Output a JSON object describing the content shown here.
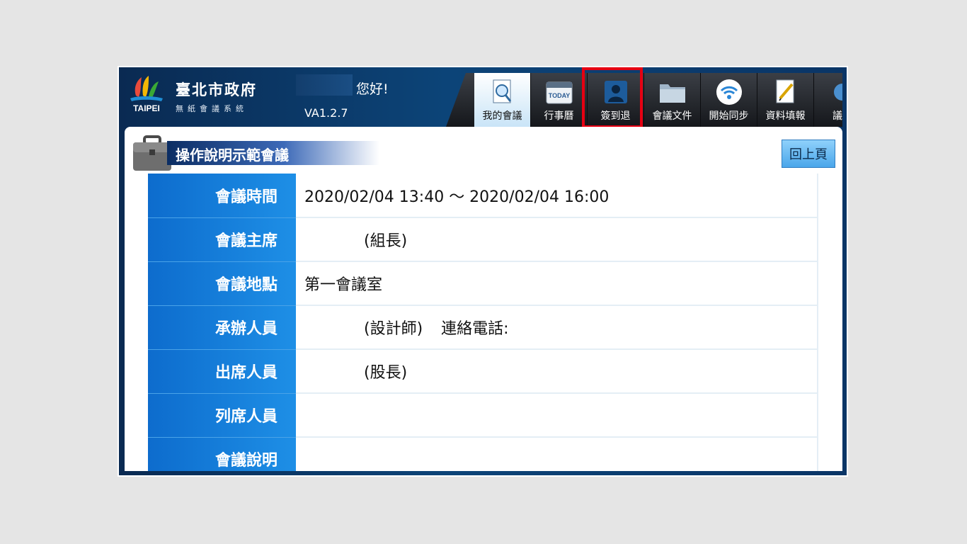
{
  "header": {
    "logo_text": "TAIPEI",
    "city_name": "臺北市政府",
    "system_name": "無紙會議系統",
    "greeting": "您好!",
    "version": "VA1.2.7"
  },
  "toolbar": {
    "items": [
      {
        "label": "我的會議",
        "icon": "magnifier-document-icon"
      },
      {
        "label": "行事曆",
        "icon": "calendar-icon",
        "icon_text": "TODAY"
      },
      {
        "label": "簽到退",
        "icon": "person-sign-icon"
      },
      {
        "label": "會議文件",
        "icon": "folder-icon"
      },
      {
        "label": "開始同步",
        "icon": "wifi-sync-icon"
      },
      {
        "label": "資料填報",
        "icon": "pen-document-icon"
      },
      {
        "label": "議事",
        "icon": "agenda-icon"
      }
    ],
    "active_index": 0,
    "highlighted_index": 2,
    "highlight_color": "#e60012"
  },
  "meeting": {
    "title": "操作說明示範會議",
    "back_label": "回上頁",
    "rows": [
      {
        "label": "會議時間",
        "value": "2020/02/04 13:40 ～ 2020/02/04 16:00"
      },
      {
        "label": "會議主席",
        "value": "(組長)"
      },
      {
        "label": "會議地點",
        "value": "第一會議室"
      },
      {
        "label": "承辦人員",
        "value": "(設計師)",
        "extra": "連絡電話:"
      },
      {
        "label": "出席人員",
        "value": "(股長)"
      },
      {
        "label": "列席人員",
        "value": ""
      },
      {
        "label": "會議說明",
        "value": ""
      }
    ]
  },
  "colors": {
    "header_bg": "#0c4478",
    "label_bg": "#1479d8",
    "button_bg": "#6cbcf3"
  }
}
